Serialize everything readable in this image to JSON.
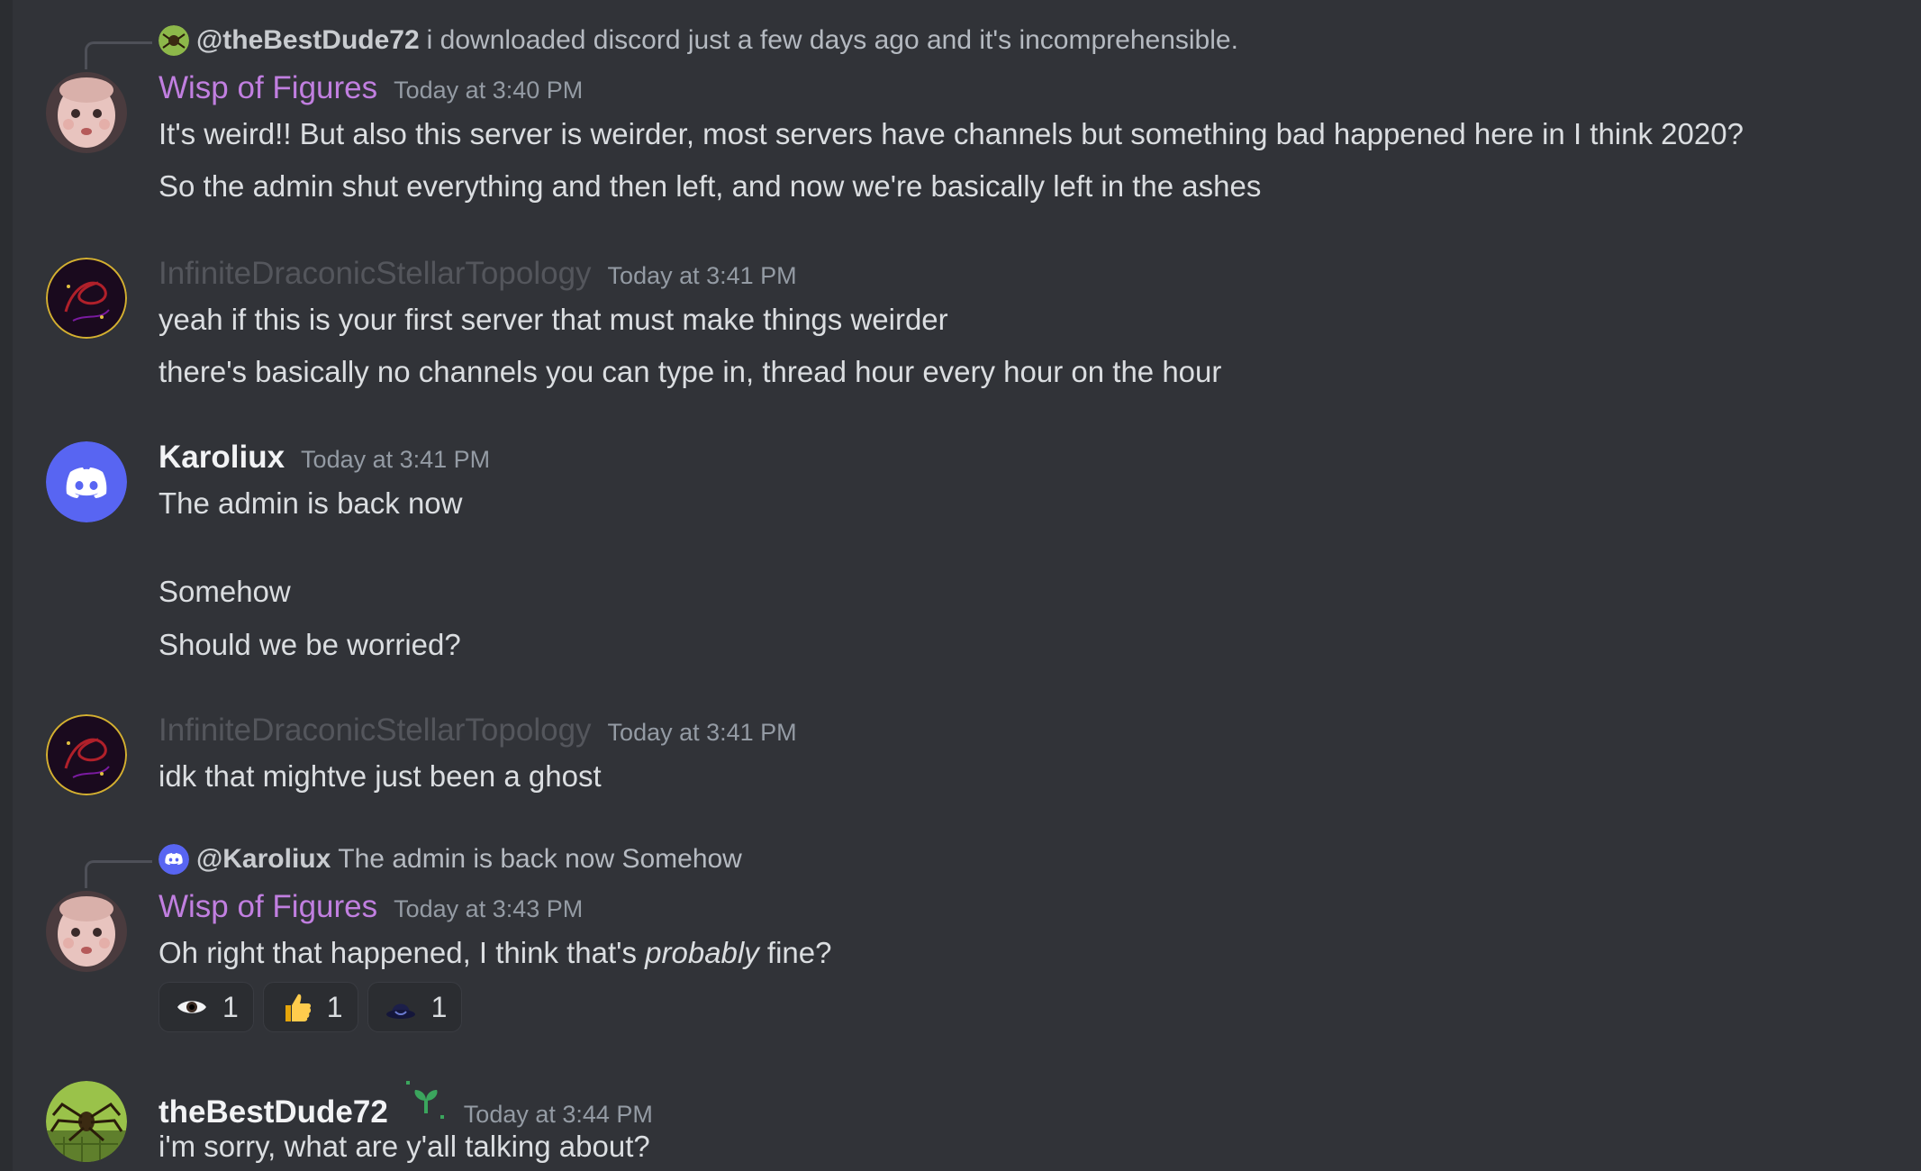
{
  "messages": [
    {
      "reply": {
        "mention": "@theBestDude72",
        "text": "i downloaded discord just a few days ago and it's incomprehensible."
      },
      "author": "Wisp of Figures",
      "timestamp": "Today at 3:40 PM",
      "lines": [
        "It's weird!! But also this server is weirder, most servers have channels but something bad happened here in I think 2020?",
        "So the admin shut everything and then left, and now we're basically left in the ashes"
      ]
    },
    {
      "author": "InfiniteDraconicStellarTopology",
      "timestamp": "Today at 3:41 PM",
      "lines": [
        "yeah if this is your first server that must make things weirder",
        "there's basically no channels you can type in, thread hour every hour on the hour"
      ]
    },
    {
      "author": "Karoliux",
      "timestamp": "Today at 3:41 PM",
      "lines": [
        "The admin is back now",
        "Somehow",
        "Should we be worried?"
      ]
    },
    {
      "author": "InfiniteDraconicStellarTopology",
      "timestamp": "Today at 3:41 PM",
      "lines": [
        "idk that mightve just been a ghost"
      ]
    },
    {
      "reply": {
        "mention": "@Karoliux",
        "text": "The admin is back now Somehow"
      },
      "author": "Wisp of Figures",
      "timestamp": "Today at 3:43 PM",
      "text_before": "Oh right that happened, I think that's ",
      "text_italic": "probably",
      "text_after": " fine?",
      "reactions": [
        {
          "icon": "eye-emoji",
          "count": "1"
        },
        {
          "icon": "thumbs-up-emoji",
          "count": "1"
        },
        {
          "icon": "hat-emoji",
          "count": "1"
        }
      ]
    },
    {
      "author": "theBestDude72",
      "timestamp": "Today at 3:44 PM",
      "lines": [
        "i'm sorry, what are y'all talking about?"
      ]
    }
  ],
  "colors": {
    "background": "#313338",
    "wisp_name": "#c17fe0",
    "infinite_name": "#54565c",
    "discord_blurple": "#5865f2"
  }
}
